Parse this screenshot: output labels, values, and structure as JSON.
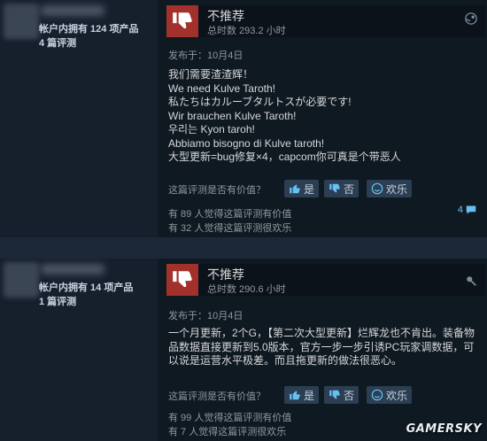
{
  "reviews": [
    {
      "owned": "帐户内拥有 124 项产品",
      "reviews_count": "4 篇评测",
      "recommendation": "不推荐",
      "hours": "总时数 293.2 小时",
      "posted": "发布于：10月4日",
      "lines": [
        "我们需要渣渣辉！",
        "We need Kulve Taroth!",
        "私たちはカルーブタルトスが必要です!",
        "Wir brauchen Kulve Taroth!",
        "우리는 Kyon taroh!",
        "Abbiamo bisogno di Kulve taroth!",
        "大型更新=bug修复×4，capcom你可真是个带恶人"
      ],
      "helpful_question": "这篇评测是否有价值？",
      "yes_label": "是",
      "no_label": "否",
      "funny_label": "欢乐",
      "helpful_stat": "有 89 人觉得这篇评测有价值",
      "funny_stat": "有 32 人觉得这篇评测很欢乐",
      "comments": "4"
    },
    {
      "owned": "帐户内拥有 14 项产品",
      "reviews_count": "1 篇评测",
      "recommendation": "不推荐",
      "hours": "总时数 290.6 小时",
      "posted": "发布于：10月4日",
      "paragraph": "一个月更新，2个G，【第二次大型更新】烂辉龙也不肯出。装备物品数据直接更新到5.0版本，官方一步一步引诱PC玩家调数据，可以说是运营水平极差。而且拖更新的做法很恶心。",
      "helpful_question": "这篇评测是否有价值？",
      "yes_label": "是",
      "no_label": "否",
      "funny_label": "欢乐",
      "helpful_stat": "有 99 人觉得这篇评测有价值",
      "funny_stat": "有 7 人觉得这篇评测很欢乐"
    }
  ],
  "watermark": "GAMERSKY",
  "colors": {
    "thumb_down_bg": "#a3312b",
    "link_blue": "#66c0f4",
    "panel": "#16202d"
  }
}
